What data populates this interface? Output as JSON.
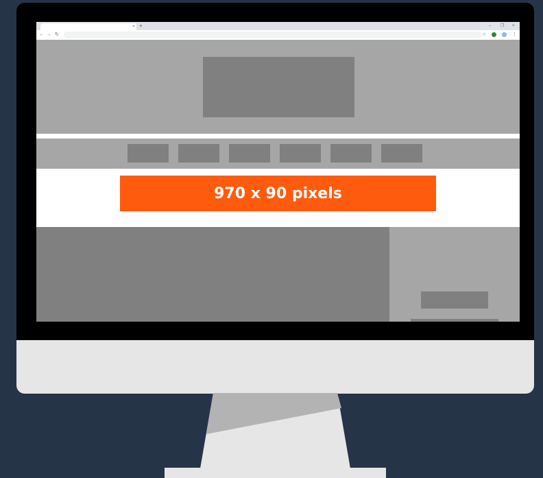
{
  "browser": {
    "tab_close_glyph": "×",
    "new_tab_glyph": "+",
    "window_controls": {
      "minimize": "–",
      "maximize": "❐",
      "close": "×"
    },
    "nav": {
      "back": "←",
      "forward": "→",
      "reload": "↻"
    },
    "bookmark_glyph": "☆",
    "menu_glyph": "⋮"
  },
  "ad": {
    "label": "970 x 90 pixels",
    "color": "#fe5b0e"
  },
  "colors": {
    "background": "#253447",
    "placeholder_light": "#a6a6a6",
    "placeholder_dark": "#808080"
  }
}
